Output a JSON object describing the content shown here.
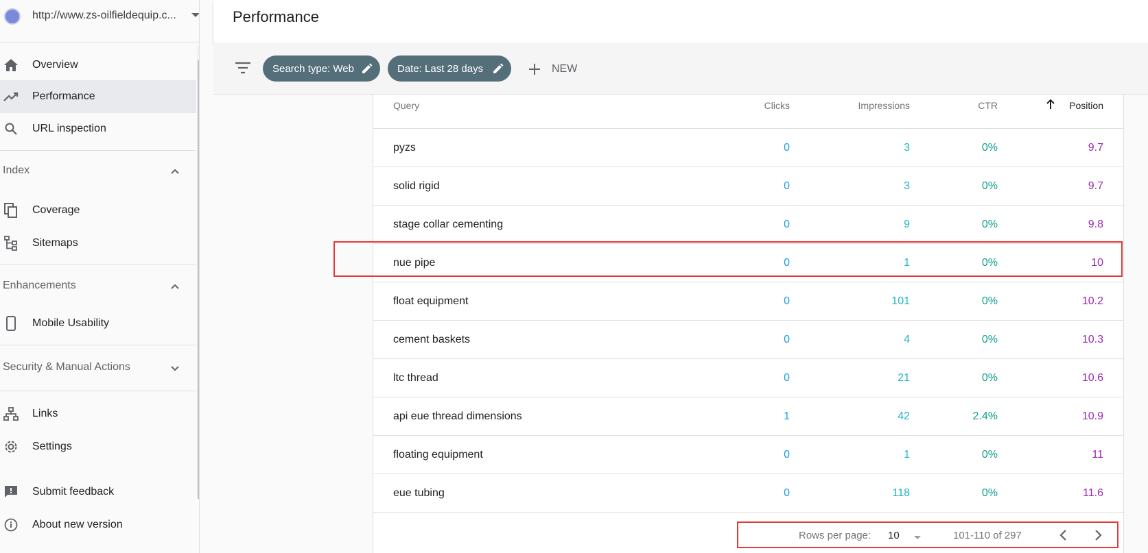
{
  "property": {
    "url": "http://www.zs-oilfieldequip.c..."
  },
  "sidebar": {
    "overview": "Overview",
    "performance": "Performance",
    "url_inspection": "URL inspection",
    "index_section": "Index",
    "coverage": "Coverage",
    "sitemaps": "Sitemaps",
    "enhancements_section": "Enhancements",
    "mobile_usability": "Mobile Usability",
    "security_section": "Security & Manual Actions",
    "links": "Links",
    "settings": "Settings",
    "submit_feedback": "Submit feedback",
    "about_new_version": "About new version"
  },
  "header": {
    "title": "Performance"
  },
  "toolbar": {
    "chip_search_type": "Search type: Web",
    "chip_date": "Date: Last 28 days",
    "new_label": "NEW"
  },
  "table": {
    "headers": {
      "query": "Query",
      "clicks": "Clicks",
      "impressions": "Impressions",
      "ctr": "CTR",
      "position": "Position"
    },
    "sort_column": "Position",
    "sort_direction": "ascending",
    "rows": [
      {
        "query": "pyzs",
        "clicks": "0",
        "impressions": "3",
        "ctr": "0%",
        "position": "9.7"
      },
      {
        "query": "solid rigid",
        "clicks": "0",
        "impressions": "3",
        "ctr": "0%",
        "position": "9.7"
      },
      {
        "query": "stage collar cementing",
        "clicks": "0",
        "impressions": "9",
        "ctr": "0%",
        "position": "9.8"
      },
      {
        "query": "nue pipe",
        "clicks": "0",
        "impressions": "1",
        "ctr": "0%",
        "position": "10"
      },
      {
        "query": "float equipment",
        "clicks": "0",
        "impressions": "101",
        "ctr": "0%",
        "position": "10.2"
      },
      {
        "query": "cement baskets",
        "clicks": "0",
        "impressions": "4",
        "ctr": "0%",
        "position": "10.3"
      },
      {
        "query": "ltc thread",
        "clicks": "0",
        "impressions": "21",
        "ctr": "0%",
        "position": "10.6"
      },
      {
        "query": "api eue thread dimensions",
        "clicks": "1",
        "impressions": "42",
        "ctr": "2.4%",
        "position": "10.9"
      },
      {
        "query": "floating equipment",
        "clicks": "0",
        "impressions": "1",
        "ctr": "0%",
        "position": "11"
      },
      {
        "query": "eue tubing",
        "clicks": "0",
        "impressions": "118",
        "ctr": "0%",
        "position": "11.6"
      }
    ]
  },
  "pagination": {
    "rows_per_page_label": "Rows per page:",
    "rows_per_page": "10",
    "range": "101-110 of 297"
  },
  "colors": {
    "clicks": "#1a9be6",
    "impressions": "#1fb5c5",
    "ctr": "#0e9f8a",
    "position": "#9c27b0",
    "chip": "#546e7a",
    "highlight": "#e53935"
  }
}
